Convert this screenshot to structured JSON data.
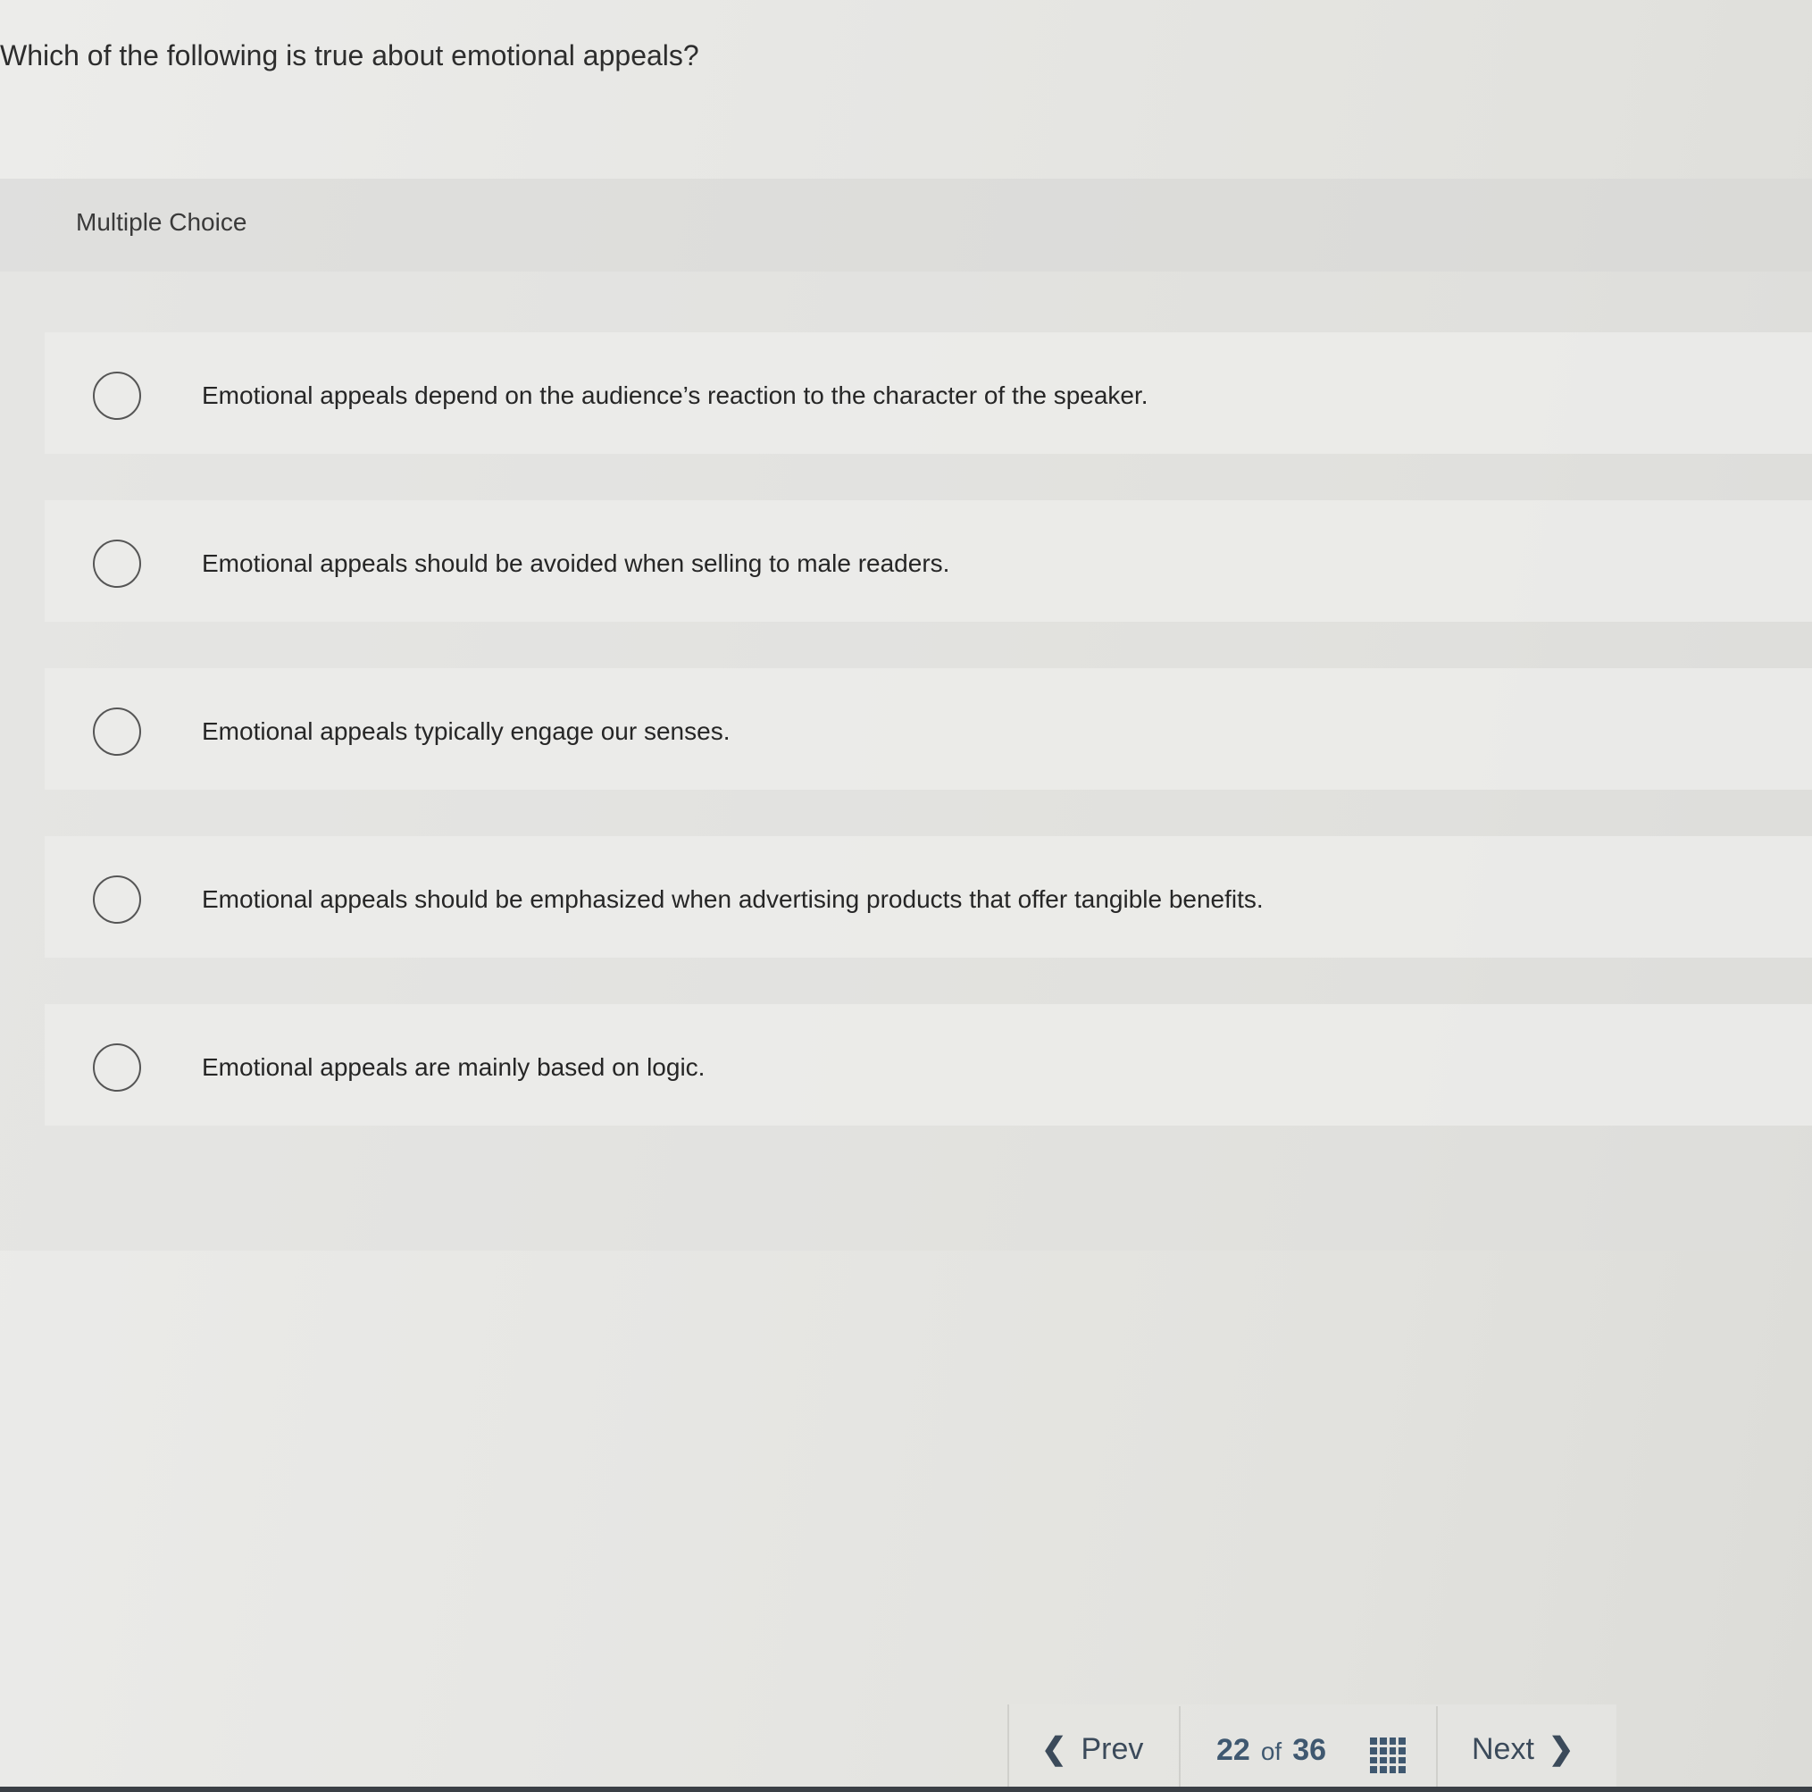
{
  "question": {
    "text": "Which of the following is true about emotional appeals?"
  },
  "section": {
    "label": "Multiple Choice"
  },
  "options": [
    {
      "text": "Emotional appeals depend on the audience’s reaction to the character of the speaker.",
      "selected": false
    },
    {
      "text": "Emotional appeals should be avoided when selling to male readers.",
      "selected": false
    },
    {
      "text": "Emotional appeals typically engage our senses.",
      "selected": false
    },
    {
      "text": "Emotional appeals should be emphasized when advertising products that offer tangible benefits.",
      "selected": false
    },
    {
      "text": "Emotional appeals are mainly based on logic.",
      "selected": false
    }
  ],
  "navigation": {
    "prev_label": "Prev",
    "next_label": "Next",
    "current_page": "22",
    "of_label": "of",
    "total_pages": "36",
    "prev_icon": "chevron-left-icon",
    "next_icon": "chevron-right-icon",
    "grid_icon": "question-grid-icon"
  },
  "colors": {
    "nav_accent": "#3f5870",
    "text": "#262626"
  }
}
